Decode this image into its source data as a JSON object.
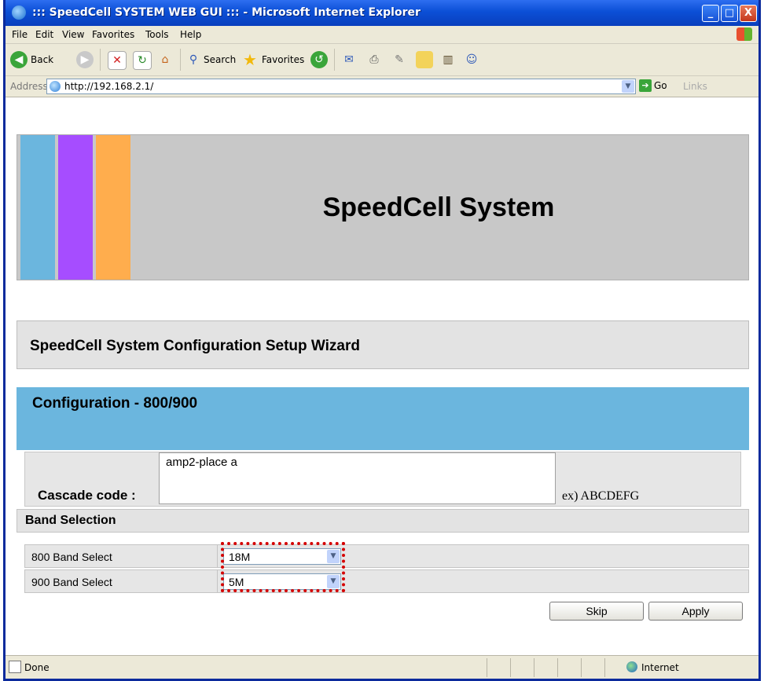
{
  "window": {
    "title": "::: SpeedCell SYSTEM WEB GUI ::: - Microsoft Internet Explorer",
    "minimize": "_",
    "maximize": "□",
    "close": "X"
  },
  "menu": [
    "File",
    "Edit",
    "View",
    "Favorites",
    "Tools",
    "Help"
  ],
  "toolbar": {
    "back": "Back",
    "search": "Search",
    "favorites": "Favorites"
  },
  "address": {
    "label": "Address",
    "url": "http://192.168.2.1/",
    "go": "Go",
    "links": "Links"
  },
  "page": {
    "banner_title": "SpeedCell System",
    "stripe_colors": [
      "#6bb6de",
      "#a64dff",
      "#ffad4d"
    ],
    "wizard_title": "SpeedCell System Configuration Setup Wizard",
    "config_title": "Configuration - 800/900",
    "cascade": {
      "label": "Cascade code :",
      "value": "amp2-place a",
      "example": "ex) ABCDEFG"
    },
    "band_selection_title": "Band Selection",
    "bands": [
      {
        "label": "800 Band Select",
        "value": "18M"
      },
      {
        "label": "900 Band Select",
        "value": "5M"
      }
    ],
    "skip_button": "Skip",
    "apply_button": "Apply"
  },
  "status": {
    "text": "Done",
    "zone": "Internet"
  },
  "colors": {
    "titlebar": "#0b4fd6",
    "banner_bg": "#c8c8c8",
    "config_bar": "#6bb6de",
    "highlight": "#d40000"
  }
}
